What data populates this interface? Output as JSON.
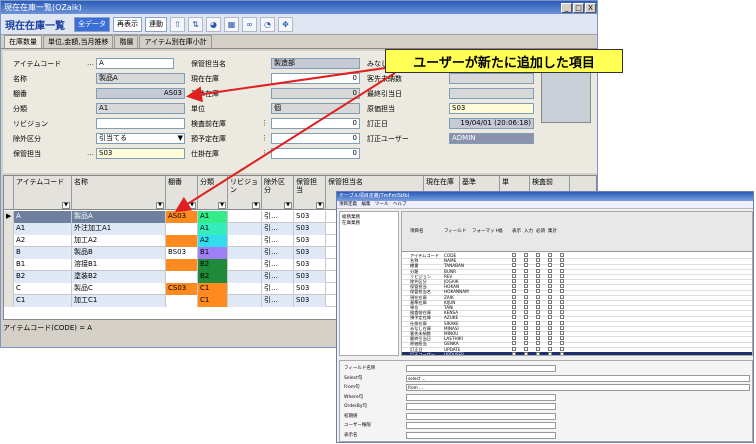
{
  "window": {
    "title": "現在在庫一覧(OZaik)",
    "min_btn": "_",
    "max_btn": "□",
    "close_btn": "X"
  },
  "toolbar": {
    "title": "現在在庫一覧",
    "all_data": "全データ",
    "redisplay": "再表示",
    "link": "連動"
  },
  "tabs": [
    "在庫数量",
    "単位,金額,当月推移",
    "階層",
    "アイテム別在庫小計"
  ],
  "form": {
    "item_code_label": "アイテムコード",
    "item_code": "A",
    "name_label": "名称",
    "name": "製品A",
    "shelf_label": "棚番",
    "shelf": "AS03",
    "category_label": "分類",
    "category": "A1",
    "revision_label": "リビジョン",
    "revision": "",
    "exclude_label": "除外区分",
    "exclude": "引当てる",
    "manager_label": "保管担当",
    "manager": "S03",
    "manager_name_label": "保管担当名",
    "manager_name": "製造部",
    "current_stock_label": "現在在庫",
    "current_stock": "0",
    "basic_stock_label": "基準在庫",
    "basic_stock": "0",
    "unit_label": "単位",
    "unit": "個",
    "inspection_label": "検査前在庫",
    "inspection": "0",
    "consigned_label": "預予定在庫",
    "consigned": "0",
    "wip_label": "仕掛在庫",
    "wip": "0",
    "col3_r1_label": "みなし",
    "col3_r2_label": "客先未納数",
    "col3_r3_label": "最終引当日",
    "col3_r4_label": "原価担当",
    "col3_r4": "S03",
    "col3_r5_label": "訂正日",
    "col3_r5": "19/04/01 (20:06:18)",
    "col3_r6_label": "訂正ユーザー",
    "col3_r6": "ADMIN"
  },
  "callout": "ユーザーが新たに追加した項目",
  "grid": {
    "headers": [
      "アイテムコード",
      "名称",
      "棚番",
      "分類",
      "リビジョン",
      "除外区分",
      "保管担当",
      "保管担当名",
      "現在在庫",
      "基準",
      "単",
      "検査前"
    ],
    "rows": [
      {
        "code": "A",
        "name": "製品A",
        "shelf": "AS03",
        "cat": "A1",
        "exc": "引…",
        "mgr": "S03",
        "color": "#6f7f9f",
        "shelfcolor": "#ff8a1f",
        "catcolor": "#33ee88"
      },
      {
        "code": "A1",
        "name": "外注加工A1",
        "shelf": "",
        "cat": "A1",
        "exc": "引…",
        "mgr": "S03",
        "color": "#dfe8f5",
        "shelfcolor": "#ffffff",
        "catcolor": "#33eebb"
      },
      {
        "code": "A2",
        "name": "加工A2",
        "shelf": "",
        "cat": "A2",
        "exc": "引…",
        "mgr": "S03",
        "color": "#ffffff",
        "shelfcolor": "#ff8a1f",
        "catcolor": "#33ddee"
      },
      {
        "code": "B",
        "name": "製品B",
        "shelf": "BS03",
        "cat": "B1",
        "exc": "引…",
        "mgr": "S03",
        "color": "#dfe8f5",
        "shelfcolor": "#ffffff",
        "catcolor": "#9e7ff5"
      },
      {
        "code": "B1",
        "name": "溶接B1",
        "shelf": "",
        "cat": "B2",
        "exc": "引…",
        "mgr": "S03",
        "color": "#ffffff",
        "shelfcolor": "#ff8a1f",
        "catcolor": "#1f8a3a"
      },
      {
        "code": "B2",
        "name": "塗装B2",
        "shelf": "",
        "cat": "B2",
        "exc": "引…",
        "mgr": "S03",
        "color": "#dfe8f5",
        "shelfcolor": "#ffffff",
        "catcolor": "#1f8a3a"
      },
      {
        "code": "C",
        "name": "製品C",
        "shelf": "CS03",
        "cat": "C1",
        "exc": "引…",
        "mgr": "S03",
        "color": "#ffffff",
        "shelfcolor": "#ff8a1f",
        "catcolor": "#ff8a1f"
      },
      {
        "code": "C1",
        "name": "加工C1",
        "shelf": "",
        "cat": "C1",
        "exc": "引…",
        "mgr": "S03",
        "color": "#dfe8f5",
        "shelfcolor": "#ffffff",
        "catcolor": "#ff8a1f"
      }
    ]
  },
  "status": "アイテムコード(CODE) = A",
  "win2": {
    "title": "テーブル項目定義(TmFmlStIb)",
    "menu": "項目定義　編集　ツール　ヘルプ",
    "tree": [
      "総務業務",
      "在庫業務"
    ],
    "head": [
      "項目名",
      "フィールド",
      "フォーマット",
      "幅",
      "表示",
      "入力",
      "必須",
      "集計"
    ],
    "rows": [
      [
        "アイテムコード",
        "CODE"
      ],
      [
        "名称",
        "NAME"
      ],
      [
        "棚番",
        "TANABAN"
      ],
      [
        "分類",
        "BUNR"
      ],
      [
        "リビジョン",
        "REV"
      ],
      [
        "除外区分",
        "JOGAIK"
      ],
      [
        "保管担当",
        "HOKAN"
      ],
      [
        "保管担当名",
        "HOKANNAM"
      ],
      [
        "現在在庫",
        "ZAIK"
      ],
      [
        "基準在庫",
        "KIJUN"
      ],
      [
        "単位",
        "TANI"
      ],
      [
        "検査前在庫",
        "KENSA"
      ],
      [
        "預予定在庫",
        "AZUKE"
      ],
      [
        "仕掛在庫",
        "SIKAKE"
      ],
      [
        "みなし在庫",
        "MINASI"
      ],
      [
        "客先未納数",
        "MINOU"
      ],
      [
        "最終引当日",
        "LASTHIKI"
      ],
      [
        "原価担当",
        "GENKA"
      ],
      [
        "訂正日",
        "UPDATE"
      ],
      [
        "訂正ユーザー",
        "UPDUSER"
      ]
    ],
    "bottom_labels": [
      "フィールド名称",
      "Select句",
      "From句",
      "Where句",
      "OrderBy句",
      "初期値",
      "ユーザー権限",
      "表示名"
    ],
    "bottom_values": [
      "",
      "select ...",
      "from ...",
      "",
      "",
      "",
      "",
      ""
    ]
  }
}
